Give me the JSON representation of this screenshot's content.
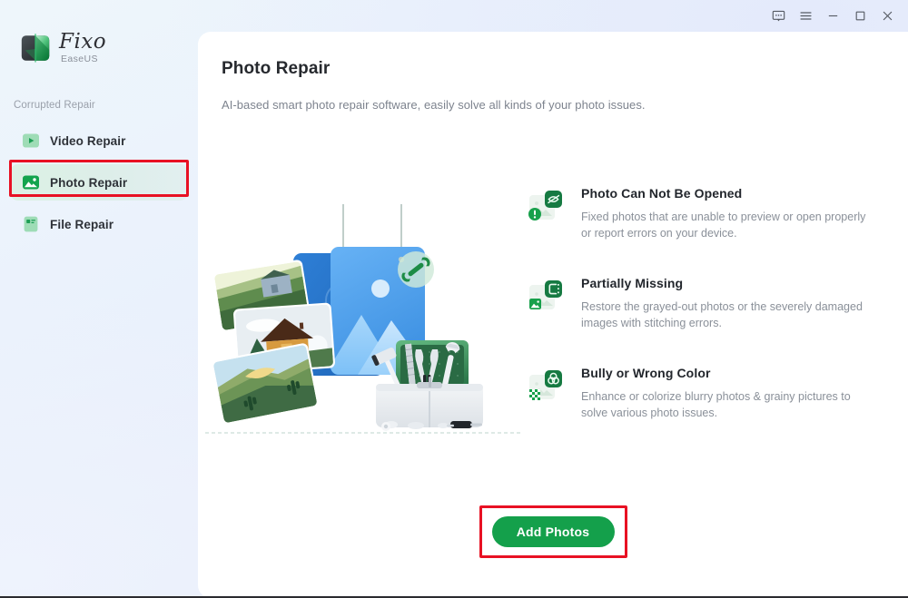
{
  "window": {
    "controls": [
      {
        "name": "feedback-icon",
        "label": "Feedback"
      },
      {
        "name": "menu-icon",
        "label": "Menu"
      },
      {
        "name": "minimize-icon",
        "label": "Minimize"
      },
      {
        "name": "maximize-icon",
        "label": "Maximize"
      },
      {
        "name": "close-icon",
        "label": "Close"
      }
    ]
  },
  "brand": {
    "name": "Fixo",
    "sub": "EaseUS",
    "logo_icon": "fixo-logo-icon"
  },
  "sidebar": {
    "group_label": "Corrupted Repair",
    "items": [
      {
        "label": "Video Repair",
        "icon": "video-repair-icon",
        "active": false
      },
      {
        "label": "Photo Repair",
        "icon": "photo-repair-icon",
        "active": true
      },
      {
        "label": "File Repair",
        "icon": "file-repair-icon",
        "active": false
      }
    ],
    "highlight_target": "Photo Repair"
  },
  "main": {
    "title": "Photo Repair",
    "subtitle": "AI-based smart photo repair software, easily solve all kinds of your photo issues.",
    "illustration_name": "photo-repair-illustration",
    "features": [
      {
        "title": "Photo Can Not Be Opened",
        "desc": "Fixed photos that are unable to preview or open properly or report errors on your device.",
        "icon": "photo-not-opened-icon"
      },
      {
        "title": "Partially Missing",
        "desc": "Restore the grayed-out photos or the severely damaged images with stitching errors.",
        "icon": "partially-missing-icon"
      },
      {
        "title": "Bully or Wrong Color",
        "desc": "Enhance or colorize blurry photos & grainy pictures to solve various photo issues.",
        "icon": "wrong-color-icon"
      }
    ],
    "cta": {
      "label": "Add Photos",
      "highlighted": true
    }
  },
  "colors": {
    "brand_green": "#14a04b",
    "accent_green_light": "#dcf1e4",
    "annotation_red": "#e81123",
    "title_text": "#26292e",
    "muted_text": "#8a9099",
    "illustration_blue": "#4a9ced"
  }
}
